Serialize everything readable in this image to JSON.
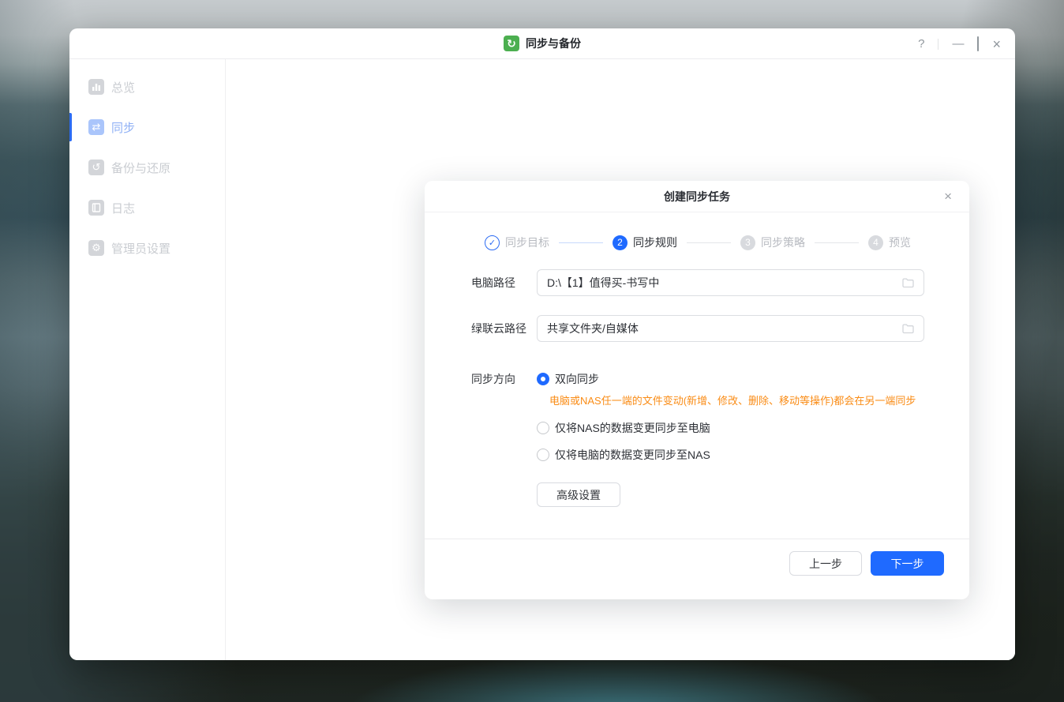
{
  "colors": {
    "accent_blue": "#1f6aff",
    "brand_green": "#4caf50",
    "warning_orange": "#fa8c16"
  },
  "titlebar": {
    "app_title": "同步与备份",
    "help": "?",
    "minimize": "—",
    "close": "×"
  },
  "sidebar": {
    "items": [
      {
        "label": "总览",
        "icon": "overview-icon",
        "active": false
      },
      {
        "label": "同步",
        "icon": "sync-icon",
        "active": true
      },
      {
        "label": "备份与还原",
        "icon": "backup-restore-icon",
        "active": false
      },
      {
        "label": "日志",
        "icon": "log-icon",
        "active": false
      },
      {
        "label": "管理员设置",
        "icon": "admin-settings-icon",
        "active": false
      }
    ]
  },
  "dialog": {
    "title": "创建同步任务",
    "close": "×",
    "steps": [
      {
        "label": "同步目标",
        "status": "done",
        "mark": "✓"
      },
      {
        "label": "同步规则",
        "status": "active",
        "num": "2"
      },
      {
        "label": "同步策略",
        "status": "pending",
        "num": "3"
      },
      {
        "label": "预览",
        "status": "pending",
        "num": "4"
      }
    ],
    "fields": [
      {
        "label": "电脑路径",
        "value": "D:\\【1】值得买-书写中"
      },
      {
        "label": "绿联云路径",
        "value": "共享文件夹/自媒体"
      }
    ],
    "direction": {
      "label": "同步方向",
      "options": [
        {
          "label": "双向同步",
          "selected": true,
          "note": "电脑或NAS任一端的文件变动(新增、修改、删除、移动等操作)都会在另一端同步"
        },
        {
          "label": "仅将NAS的数据变更同步至电脑",
          "selected": false
        },
        {
          "label": "仅将电脑的数据变更同步至NAS",
          "selected": false
        }
      ]
    },
    "advanced_button": "高级设置",
    "prev_button": "上一步",
    "next_button": "下一步"
  }
}
